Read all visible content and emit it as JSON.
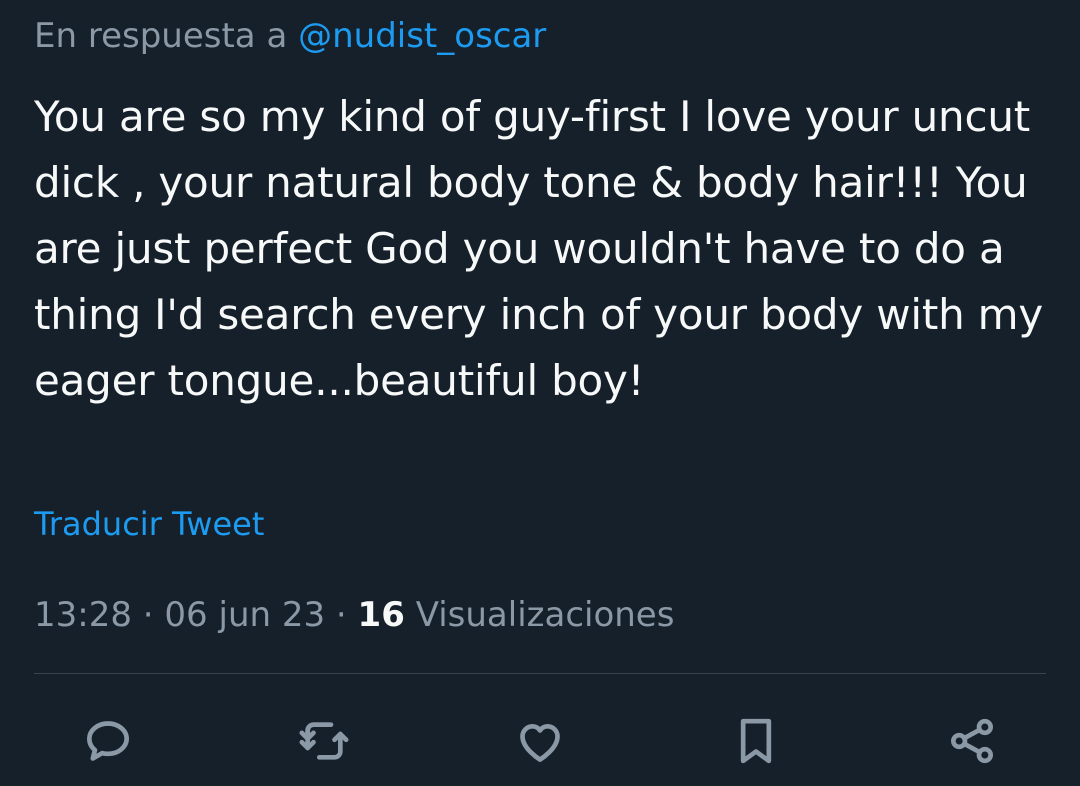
{
  "reply": {
    "prefix": "En respuesta a",
    "handle": "@nudist_oscar"
  },
  "tweet": {
    "text": "You are so my kind of guy-first I love your uncut dick , your natural body tone & body hair!!! You are just perfect God you wouldn't have to do a thing I'd search every inch of your body with my eager tongue...beautiful boy!",
    "translate_label": "Traducir Tweet",
    "time": "13:28",
    "separator": "·",
    "date": "06 jun 23",
    "views_count": "16",
    "views_label": "Visualizaciones"
  },
  "actions": [
    {
      "icon": "reply-icon"
    },
    {
      "icon": "retweet-icon"
    },
    {
      "icon": "like-icon"
    },
    {
      "icon": "bookmark-icon"
    },
    {
      "icon": "share-icon"
    }
  ],
  "colors": {
    "background": "#15202b",
    "text": "#f7f9f9",
    "secondary": "#8b98a5",
    "accent": "#1d9bf0",
    "divider": "#38444d"
  }
}
